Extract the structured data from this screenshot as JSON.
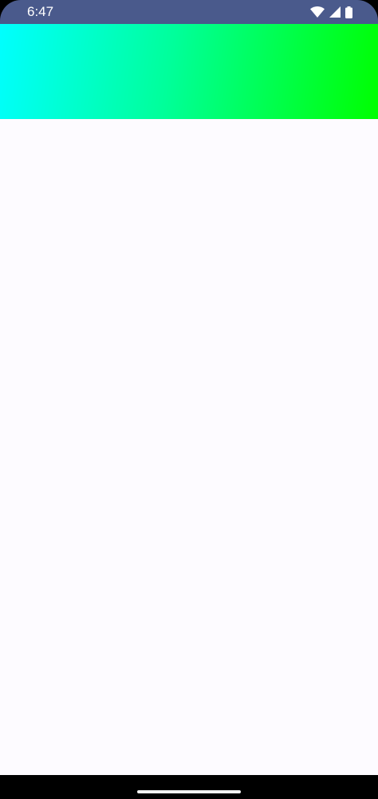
{
  "status_bar": {
    "time": "6:47",
    "icons": [
      "wifi-icon",
      "signal-icon",
      "battery-icon"
    ],
    "background_color": "#4a5a8c"
  },
  "banner": {
    "gradient_start_color": "#00ffff",
    "gradient_end_color": "#00ff00"
  },
  "content": {
    "background_color": "#fdfbff"
  },
  "navigation": {
    "handle": "home-handle"
  }
}
